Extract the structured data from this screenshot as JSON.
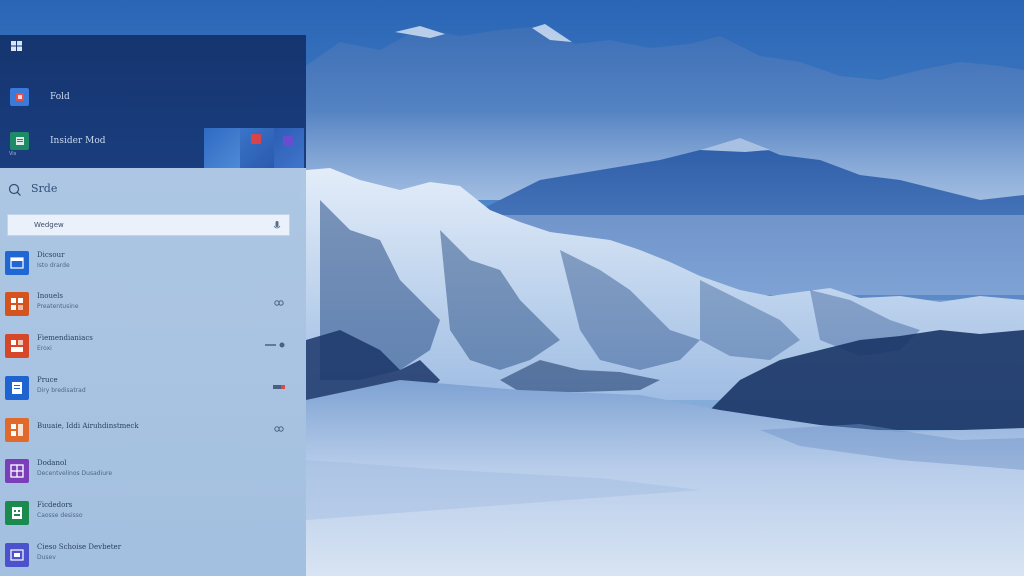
{
  "desktop": {
    "wallpaper": "snowy-mountain-landscape"
  },
  "start": {
    "top_items": [
      {
        "label": "Fold",
        "icon": "red-square-icon",
        "color": "#3a7ad8"
      },
      {
        "label": "Insider Mod",
        "sub": "Vis",
        "icon": "sheet-icon",
        "color": "#1e8a67"
      }
    ],
    "search_label": "Srde",
    "search_box": {
      "value": "Wedgew"
    },
    "apps": [
      {
        "name": "Dicsour",
        "sub": "Isto drarde",
        "icon": "window-icon",
        "color": "#2067d4"
      },
      {
        "name": "Inouels",
        "sub": "Preatentusine",
        "icon": "grid-icon",
        "color": "#d45420"
      },
      {
        "name": "Fiemendianiacs",
        "sub": "Eroxi",
        "icon": "grid-icon",
        "color": "#d64628"
      },
      {
        "name": "Pruce",
        "sub": "Diry bredisatrad",
        "icon": "window-icon",
        "color": "#1e64d0"
      },
      {
        "name": "Buuaie, Iddi Airuhdinstmeck",
        "sub": "",
        "icon": "grid-icon",
        "color": "#e06a2c"
      },
      {
        "name": "Dodanol",
        "sub": "Decentvelinos Dusadiure",
        "icon": "grid-icon",
        "color": "#7a3eb8"
      },
      {
        "name": "Ficdedors",
        "sub": "Caosse desisso",
        "icon": "sheet-icon",
        "color": "#1b8a4e"
      },
      {
        "name": "Cieso Schoise Devbeter",
        "sub": "Dusev",
        "icon": "window-icon",
        "color": "#4a52cc"
      }
    ]
  }
}
